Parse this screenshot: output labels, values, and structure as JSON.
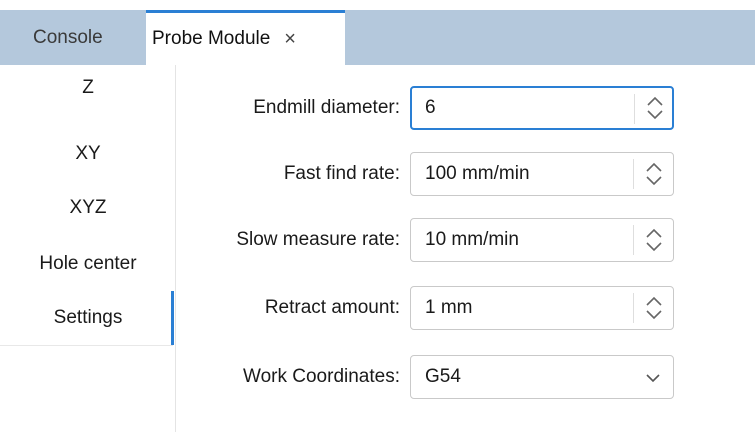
{
  "tabs": {
    "console": {
      "label": "Console"
    },
    "probe": {
      "label": "Probe Module",
      "close_glyph": "×"
    }
  },
  "sidebar": {
    "items": [
      {
        "label": "Z"
      },
      {
        "label": "XY"
      },
      {
        "label": "XYZ"
      },
      {
        "label": "Hole center"
      },
      {
        "label": "Settings",
        "selected": true
      }
    ]
  },
  "settings": {
    "endmill_diameter": {
      "label": "Endmill diameter:",
      "value": "6"
    },
    "fast_find_rate": {
      "label": "Fast find rate:",
      "value": "100 mm/min"
    },
    "slow_measure_rate": {
      "label": "Slow measure rate:",
      "value": "10 mm/min"
    },
    "retract_amount": {
      "label": "Retract amount:",
      "value": "1 mm"
    },
    "work_coordinates": {
      "label": "Work Coordinates:",
      "value": "G54"
    }
  },
  "colors": {
    "accent": "#2a7fd4",
    "tab_strip": "#b4c8dc"
  },
  "icons": {
    "spinner": "up-down-chevron-icon",
    "dropdown": "chevron-down-icon",
    "close": "close-icon"
  }
}
